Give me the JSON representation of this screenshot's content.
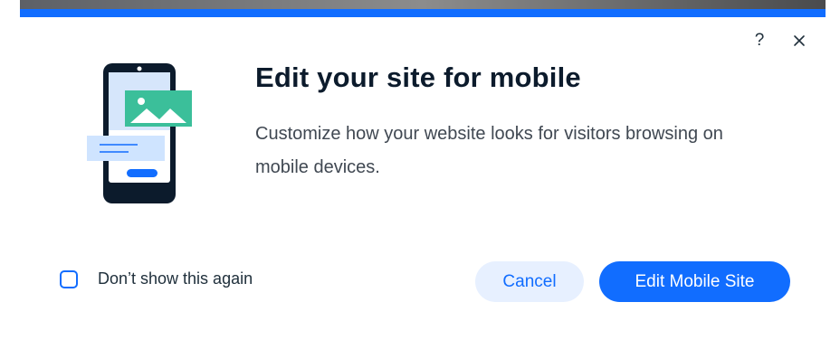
{
  "dialog": {
    "title": "Edit your site for mobile",
    "description": "Customize how your website looks for visitors browsing on mobile devices.",
    "help_label": "?",
    "dont_show_label": "Don’t show this again",
    "dont_show_checked": false,
    "cancel_label": "Cancel",
    "primary_label": "Edit Mobile Site"
  },
  "icons": {
    "help": "question-mark-icon",
    "close": "close-icon",
    "illustration": "mobile-phone-illustration"
  },
  "colors": {
    "accent": "#116dff",
    "accent_light": "#e7f0ff",
    "title": "#0c1b2c",
    "text": "#404852",
    "illustration_green": "#3bbf9a",
    "illustration_blue_light": "#cfe4ff",
    "phone_body": "#0c1b2c"
  }
}
